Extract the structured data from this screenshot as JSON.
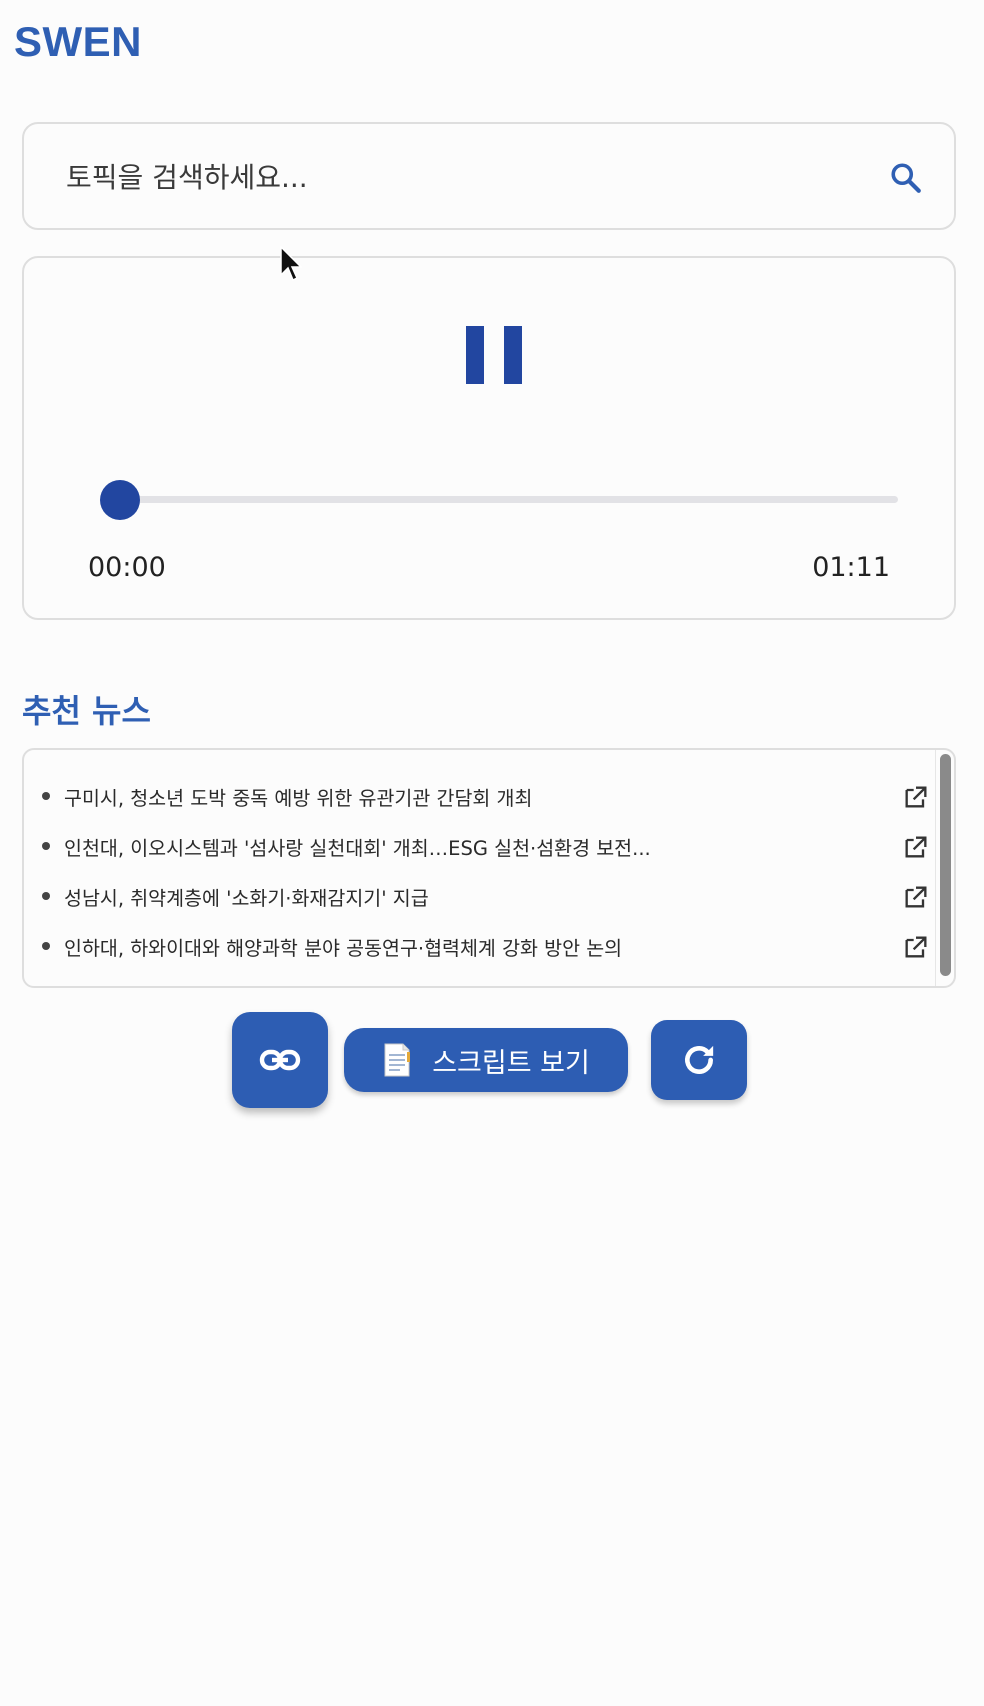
{
  "app": {
    "brand": "SWEN"
  },
  "search": {
    "placeholder": "토픽을 검색하세요..."
  },
  "player": {
    "current_time": "00:00",
    "duration": "01:11",
    "progress": 0
  },
  "news": {
    "title": "추천 뉴스",
    "items": [
      {
        "title": "구미시, 청소년 도박 중독 예방 위한 유관기관 간담회 개최"
      },
      {
        "title": "인천대, 이오시스템과 '섬사랑 실천대회' 개최…ESG 실천·섬환경 보전..."
      },
      {
        "title": "성남시, 취약계층에 '소화기·화재감지기' 지급"
      },
      {
        "title": "인하대, 하와이대와 해양과학 분야 공동연구·협력체계 강화 방안 논의"
      }
    ]
  },
  "actions": {
    "script_label": "스크립트 보기"
  },
  "icons": {
    "search": "search-icon",
    "pause": "pause-icon",
    "external": "open-in-new-icon",
    "link": "link-icon",
    "script": "document-icon",
    "refresh": "refresh-icon"
  },
  "colors": {
    "brand": "#2f5fb3",
    "accent": "#2246a0",
    "button": "#2d5db3"
  }
}
